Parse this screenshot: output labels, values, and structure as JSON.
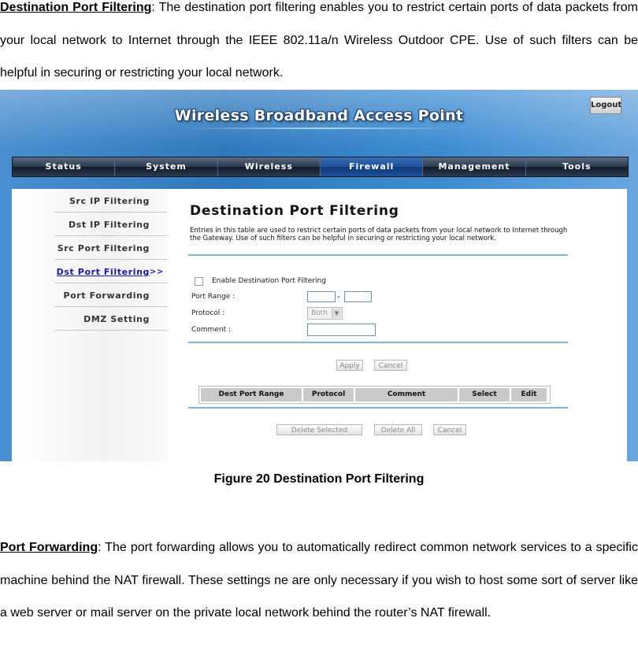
{
  "doc": {
    "para1_term": "Destination Port Filtering",
    "para1_body": ": The destination port filtering enables you to restrict certain ports of data packets from your local network to Internet through the IEEE 802.11a/n Wireless Outdoor CPE. Use of such filters can be helpful in securing or restricting your local network.",
    "caption": "Figure 20 Destination Port Filtering",
    "para2_term": "Port Forwarding",
    "para2_body": ": The port forwarding allows you to automatically redirect common network services to a specific machine behind the NAT firewall. These settings ne are only necessary if you wish to host some sort of server like a web server or mail server on the private local network behind the router’s NAT firewall."
  },
  "screen": {
    "banner": "Wireless Broadband Access Point",
    "logout": "Logout",
    "nav": [
      "Status",
      "System",
      "Wireless",
      "Firewall",
      "Management",
      "Tools"
    ],
    "nav_active": "Firewall",
    "sidebar": [
      "Src IP Filtering",
      "Dst IP Filtering",
      "Src Port Filtering",
      "Dst Port Filtering",
      "Port Forwarding",
      "DMZ Setting"
    ],
    "sidebar_active": "Dst Port Filtering",
    "sidebar_arrow": ">>",
    "title": "Destination Port Filtering",
    "description": "Entries in this table are used to restrict certain ports of data packets from your local network to Internet through the Gateway. Use of such filters can be helpful in securing or restricting your local network.",
    "enable_label": "Enable Destination Port Filtering",
    "port_range_label": "Port Range :",
    "port_range_sep": "-",
    "protocol_label": "Protocol :",
    "protocol_value": "Both",
    "comment_label": "Comment :",
    "apply": "Apply",
    "cancel": "Cancel",
    "table_headers": [
      "Dest Port Range",
      "Protocol",
      "Comment",
      "Select",
      "Edit"
    ],
    "delete_selected": "Delete Selected",
    "delete_all": "Delete All",
    "cancel2": "Cancel"
  },
  "colors": {
    "accent_blue": "#2e79bd",
    "nav_active": "#1e4f97",
    "rule": "#7fb3d9"
  }
}
